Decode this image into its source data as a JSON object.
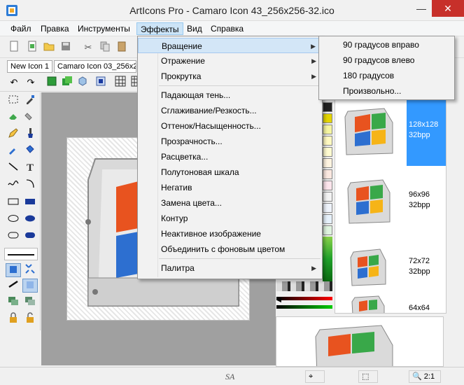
{
  "window": {
    "title": "ArtIcons Pro - Camaro Icon 43_256x256-32.ico",
    "minimize_icon": "—",
    "close_icon": "✕"
  },
  "menubar": {
    "items": [
      "Файл",
      "Правка",
      "Инструменты",
      "Эффекты",
      "Вид",
      "Справка"
    ],
    "active": "Эффекты"
  },
  "doc_tabs": [
    "New Icon 1",
    "Camaro Icon 03_256x256"
  ],
  "effects_menu": {
    "submenu_items": [
      "Вращение",
      "Отражение",
      "Прокрутка"
    ],
    "items": [
      "Падающая тень...",
      "Сглаживание/Резкость...",
      "Оттенок/Насыщенность...",
      "Прозрачность...",
      "Расцветка...",
      "Полутоновая шкала",
      "Негатив",
      "Замена цвета...",
      "Контур",
      "Неактивное изображение",
      "Объединить с фоновым цветом"
    ],
    "palette_item": "Палитра"
  },
  "rotation_menu": {
    "items": [
      "90 градусов вправо",
      "90 градусов влево",
      "180 градусов",
      "Произвольно..."
    ]
  },
  "icon_list": [
    {
      "size": "128x128",
      "depth": "32bpp"
    },
    {
      "size": "96x96",
      "depth": "32bpp"
    },
    {
      "size": "72x72",
      "depth": "32bpp"
    },
    {
      "size": "64x64",
      "depth": ""
    }
  ],
  "statusbar": {
    "zoom": "2:1",
    "watermark": "SA"
  },
  "colors": {
    "selection": "#3399ff",
    "menu_highlight": "#d3e6f7"
  }
}
